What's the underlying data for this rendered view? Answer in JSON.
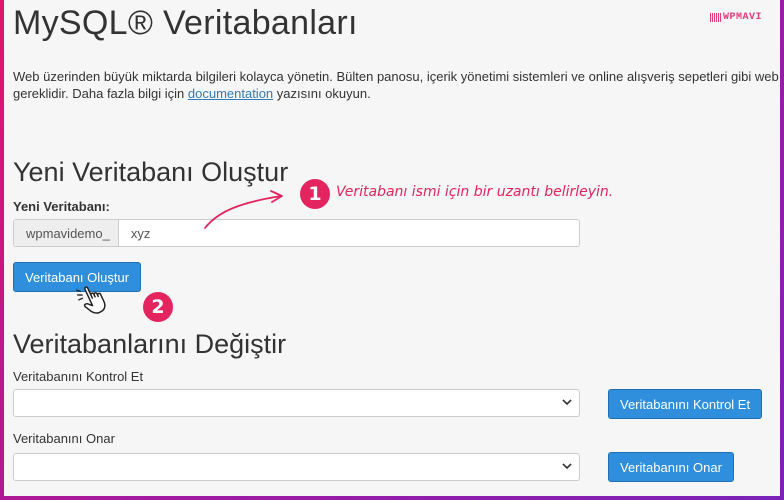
{
  "page": {
    "title": "MySQL® Veritabanları",
    "watermark": "WPMAVI",
    "description_text": "Web üzerinden büyük miktarda bilgileri kolayca yönetin. Bülten panosu, içerik yönetimi sistemleri ve online alışveriş sepetleri gibi web",
    "description_line2_before": "gereklidir. Daha fazla bilgi için ",
    "description_link": "documentation",
    "description_line2_after": " yazısını okuyun."
  },
  "create_db": {
    "heading": "Yeni Veritabanı Oluştur",
    "label": "Yeni Veritabanı:",
    "prefix": "wpmavidemo_",
    "input_value": "xyz",
    "button_label": "Veritabanı Oluştur"
  },
  "modify_db": {
    "heading": "Veritabanlarını Değiştir",
    "check_label": "Veritabanını Kontrol Et",
    "check_select_value": "",
    "check_button": "Veritabanını Kontrol Et",
    "repair_label": "Veritabanını Onar",
    "repair_select_value": "",
    "repair_button": "Veritabanını Onar"
  },
  "annotations": {
    "step1_number": "1",
    "step1_text": "Veritabanı ismi için bir uzantı belirleyin.",
    "step2_number": "2",
    "color": "#e3245f"
  },
  "colors": {
    "accent_button": "#2f8fdd",
    "link": "#337ab7",
    "frame_gradient_start": "#e0156b",
    "frame_gradient_end": "#7a22b8"
  }
}
